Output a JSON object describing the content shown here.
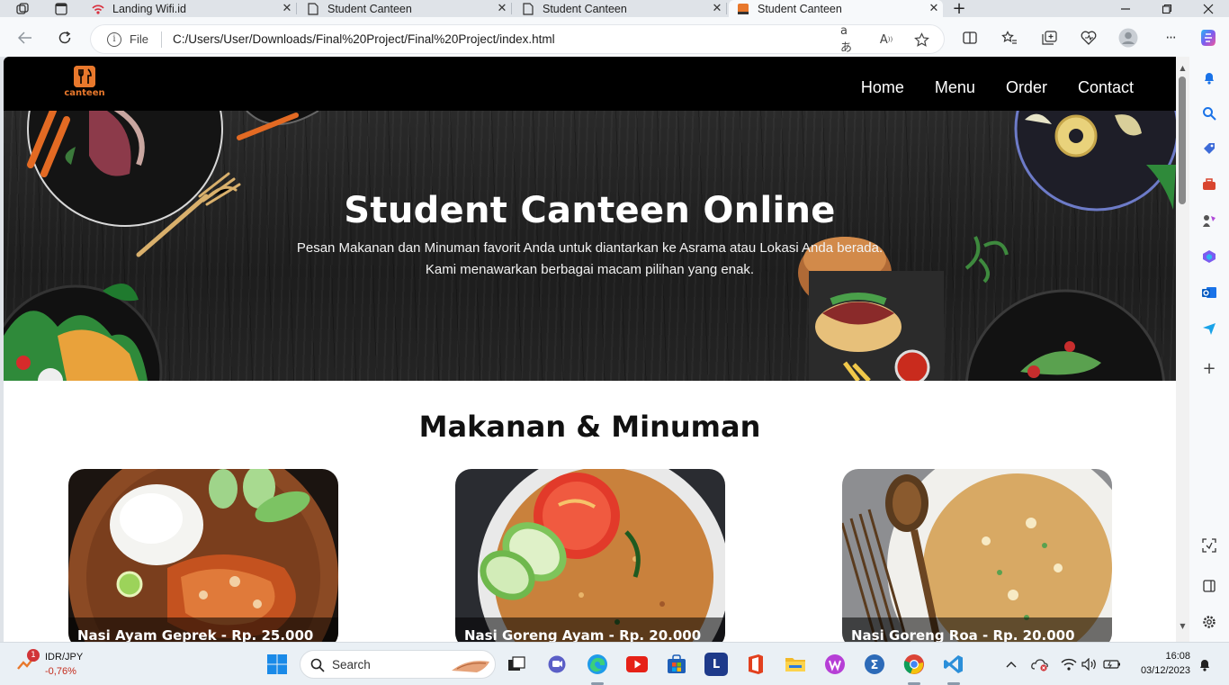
{
  "browser": {
    "tabs": [
      {
        "title": "Landing Wifi.id",
        "active": false
      },
      {
        "title": "Student Canteen",
        "active": false
      },
      {
        "title": "Student Canteen",
        "active": false
      },
      {
        "title": "Student Canteen",
        "active": true
      }
    ],
    "address": {
      "scheme_label": "File",
      "url": "C:/Users/User/Downloads/Final%20Project/Final%20Project/index.html"
    }
  },
  "site": {
    "logo_text": "canteen",
    "nav": [
      "Home",
      "Menu",
      "Order",
      "Contact"
    ],
    "hero": {
      "title": "Student Canteen Online",
      "subtitle_line1": "Pesan Makanan dan Minuman favorit Anda untuk diantarkan ke Asrama atau Lokasi Anda berada.",
      "subtitle_line2": "Kami menawarkan berbagai macam pilihan yang enak."
    },
    "section_title": "Makanan & Minuman",
    "menu_items": [
      {
        "caption": "Nasi Ayam Geprek - Rp. 25.000"
      },
      {
        "caption": "Nasi Goreng Ayam - Rp. 20.000"
      },
      {
        "caption": "Nasi Goreng Roa - Rp. 20.000"
      }
    ]
  },
  "taskbar": {
    "widget": {
      "badge": "1",
      "ticker": "IDR/JPY",
      "change": "-0,76%"
    },
    "search_label": "Search",
    "clock": {
      "time": "16:08",
      "date": "03/12/2023"
    }
  },
  "colors": {
    "accent": "#e8782c",
    "nav_bg": "#000000",
    "hero_bg": "#1f1f1f",
    "negative": "#c42b1c"
  }
}
